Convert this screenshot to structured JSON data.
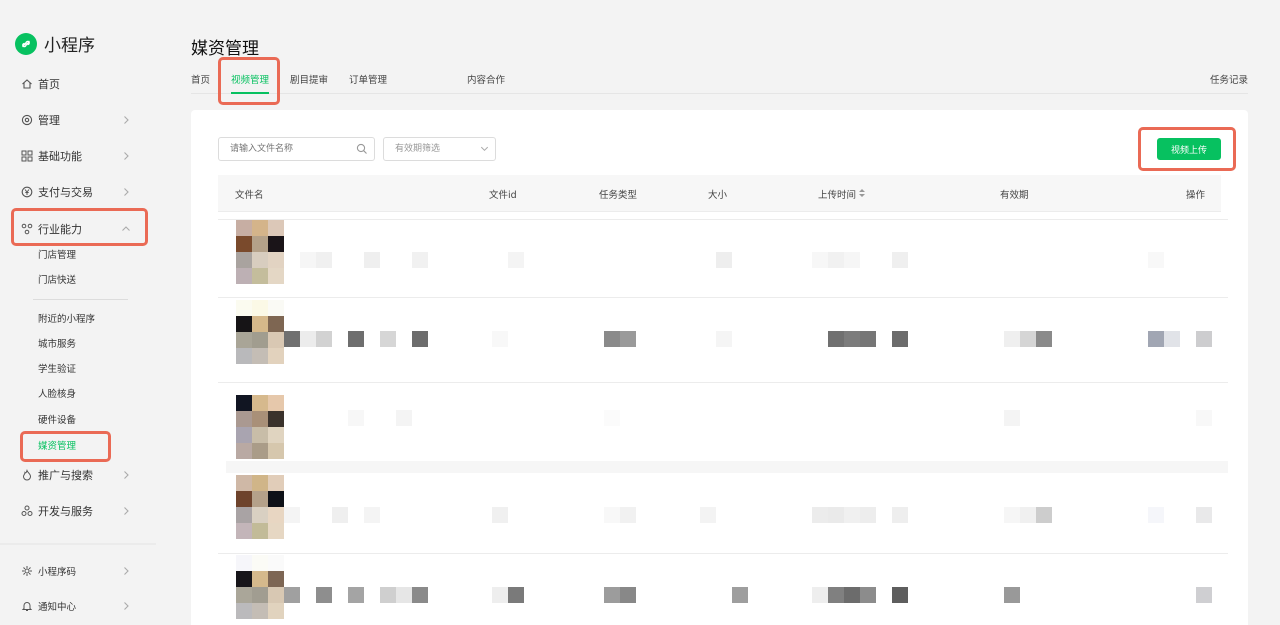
{
  "brand": {
    "name": "小程序",
    "accent": "#07c160"
  },
  "sidebar": {
    "items": [
      {
        "label": "首页",
        "icon": "home-icon"
      },
      {
        "label": "管理",
        "icon": "settings-icon"
      },
      {
        "label": "基础功能",
        "icon": "grid-icon"
      },
      {
        "label": "支付与交易",
        "icon": "yen-icon"
      },
      {
        "label": "行业能力",
        "icon": "industry-icon"
      },
      {
        "label": "推广与搜索",
        "icon": "flame-icon"
      },
      {
        "label": "开发与服务",
        "icon": "link-icon"
      }
    ],
    "sub_items": [
      "门店管理",
      "门店快送",
      "附近的小程序",
      "城市服务",
      "学生验证",
      "人脸核身",
      "硬件设备",
      "媒资管理"
    ],
    "bottom_items": [
      {
        "label": "小程序码",
        "icon": "qrcode-icon"
      },
      {
        "label": "通知中心",
        "icon": "bell-icon"
      }
    ]
  },
  "page": {
    "title": "媒资管理"
  },
  "tabs": {
    "items": [
      "首页",
      "视频管理",
      "剧目提审",
      "订单管理",
      "内容合作"
    ],
    "right": "任务记录"
  },
  "toolbar": {
    "search_placeholder": "请输入文件名称",
    "filter_label": "有效期筛选",
    "upload_label": "视频上传"
  },
  "table": {
    "columns": [
      "文件名",
      "文件id",
      "任务类型",
      "大小",
      "上传时间",
      "有效期",
      "操作"
    ]
  },
  "colors": {
    "accent": "#07c160",
    "highlight": "#ea6a55"
  }
}
